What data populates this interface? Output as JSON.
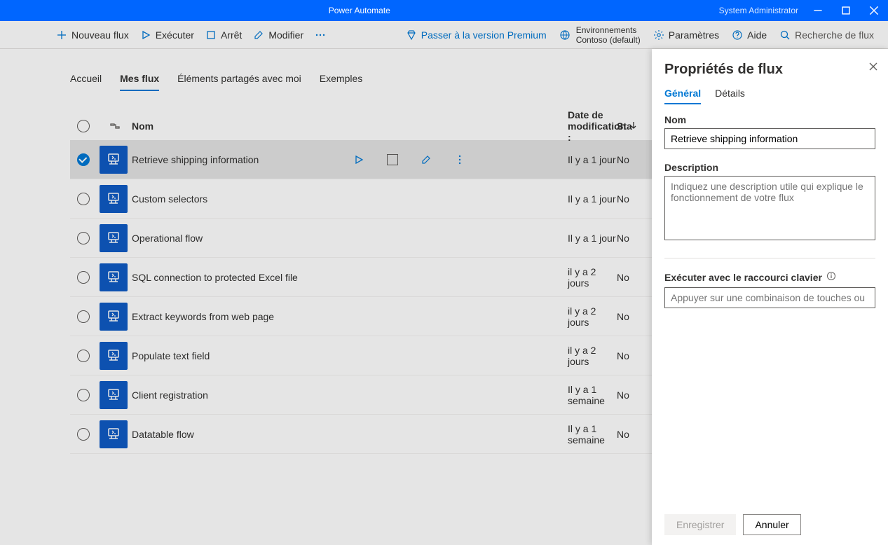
{
  "titlebar": {
    "app": "Power Automate",
    "user": "System Administrator"
  },
  "cmdbar": {
    "new_flow": "Nouveau flux",
    "run": "Exécuter",
    "stop": "Arrêt",
    "edit": "Modifier",
    "premium": "Passer à la version Premium",
    "env_label": "Environnements",
    "env_name": "Contoso (default)",
    "settings": "Paramètres",
    "help": "Aide",
    "search": "Recherche de flux"
  },
  "tabs": {
    "home": "Accueil",
    "myflows": "Mes flux",
    "shared": "Éléments partagés avec moi",
    "examples": "Exemples"
  },
  "table": {
    "col_name": "Nom",
    "col_modified": "Date de modification :",
    "col_status_short": "Sta",
    "rows": [
      {
        "name": "Retrieve shipping information",
        "modified": "Il y a 1 jour",
        "status": "No",
        "selected": true
      },
      {
        "name": "Custom selectors",
        "modified": "Il y a 1 jour",
        "status": "No"
      },
      {
        "name": "Operational flow",
        "modified": "Il y a 1 jour",
        "status": "No"
      },
      {
        "name": "SQL connection to protected Excel file",
        "modified": "il y a 2 jours",
        "status": "No"
      },
      {
        "name": "Extract keywords from web page",
        "modified": "il y a 2 jours",
        "status": "No"
      },
      {
        "name": "Populate text field",
        "modified": "il y a 2 jours",
        "status": "No"
      },
      {
        "name": "Client registration",
        "modified": "Il y a 1 semaine",
        "status": "No"
      },
      {
        "name": "Datatable flow",
        "modified": "Il y a 1 semaine",
        "status": "No"
      }
    ]
  },
  "panel": {
    "title": "Propriétés de flux",
    "tab_general": "Général",
    "tab_details": "Détails",
    "name_label": "Nom",
    "name_value": "Retrieve shipping information",
    "desc_label": "Description",
    "desc_placeholder": "Indiquez une description utile qui explique le fonctionnement de votre flux",
    "shortcut_label": "Exécuter avec le raccourci clavier",
    "shortcut_placeholder": "Appuyer sur une combinaison de touches ou",
    "save": "Enregistrer",
    "cancel": "Annuler"
  }
}
